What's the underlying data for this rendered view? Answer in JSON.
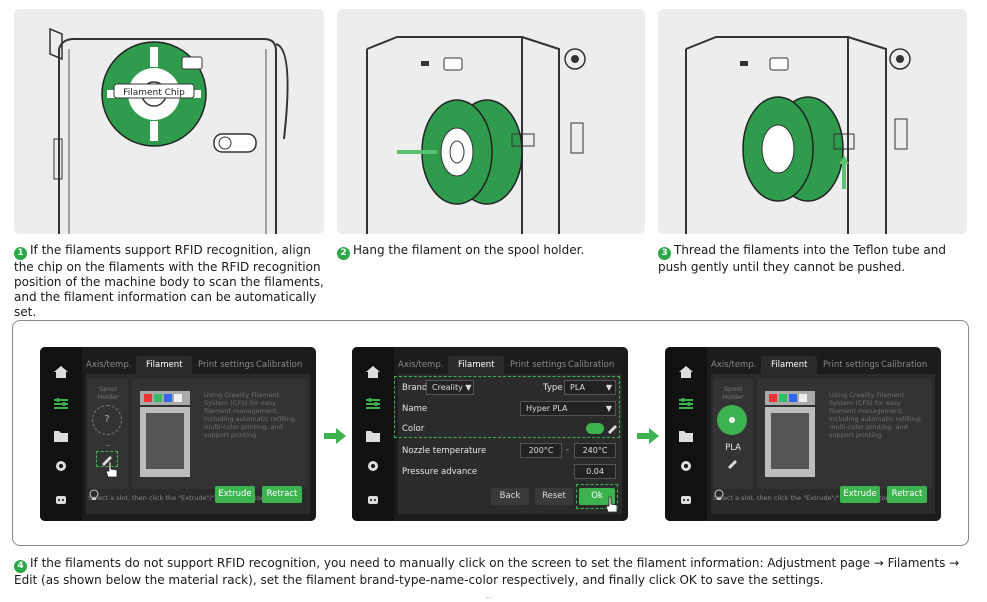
{
  "steps": {
    "s1": {
      "num": "1",
      "text": "If the filaments support RFID recognition, align the chip on the filaments with the RFID recognition position of the machine body to scan the filaments, and the filament information can be automatically set.",
      "callout": "Filament Chip"
    },
    "s2": {
      "num": "2",
      "text": "Hang the filament on the spool holder."
    },
    "s3": {
      "num": "3",
      "text": "Thread the filaments into the Teflon tube and push gently until they cannot be pushed."
    },
    "s4": {
      "num": "4",
      "text": "If the filaments do not support RFID recognition, you need to manually click on the screen to set the filament information: Adjustment page → Filaments → Edit (as shown below the material rack), set the filament brand-type-name-color respectively, and finally click OK to save the settings."
    }
  },
  "screens": {
    "tabs": [
      "Axis/temp.",
      "Filament",
      "Print settings",
      "Calibration"
    ],
    "screen1": {
      "spool_label": "Spool Holder",
      "slot_mark": "?",
      "slot_dash": "--",
      "info": "Using Creality Filament System (CFS) for easy filament management, including automatic refilling, multi-color printing, and support printing.",
      "hint": "Select a slot, then click the \"Extrude\"/\"Retract\" button.",
      "extrude": "Extrude",
      "retract": "Retract"
    },
    "screen2": {
      "brand_label": "Brand",
      "brand_value": "Creality",
      "type_label": "Type",
      "type_value": "PLA",
      "name_label": "Name",
      "name_value": "Hyper PLA",
      "color_label": "Color",
      "nozzle_label": "Nozzle temperature",
      "nozzle_min": "200°C",
      "nozzle_sep": "-",
      "nozzle_max": "240°C",
      "pressure_label": "Pressure advance",
      "pressure_value": "0.04",
      "back": "Back",
      "reset": "Reset",
      "ok": "Ok"
    },
    "screen3": {
      "spool_label": "Spool Holder",
      "slot_type": "PLA",
      "info": "Using Creality Filament System (CFS) for easy filament management, including automatic refilling, multi-color printing, and support printing.",
      "hint": "Select a slot, then click the \"Extrude\"/\"Retract\" button.",
      "extrude": "Extrude",
      "retract": "Retract"
    }
  },
  "page_mark": "--",
  "colors": {
    "accent": "#3cb34f",
    "panel": "#ededed",
    "screen": "#1c1c1c"
  }
}
